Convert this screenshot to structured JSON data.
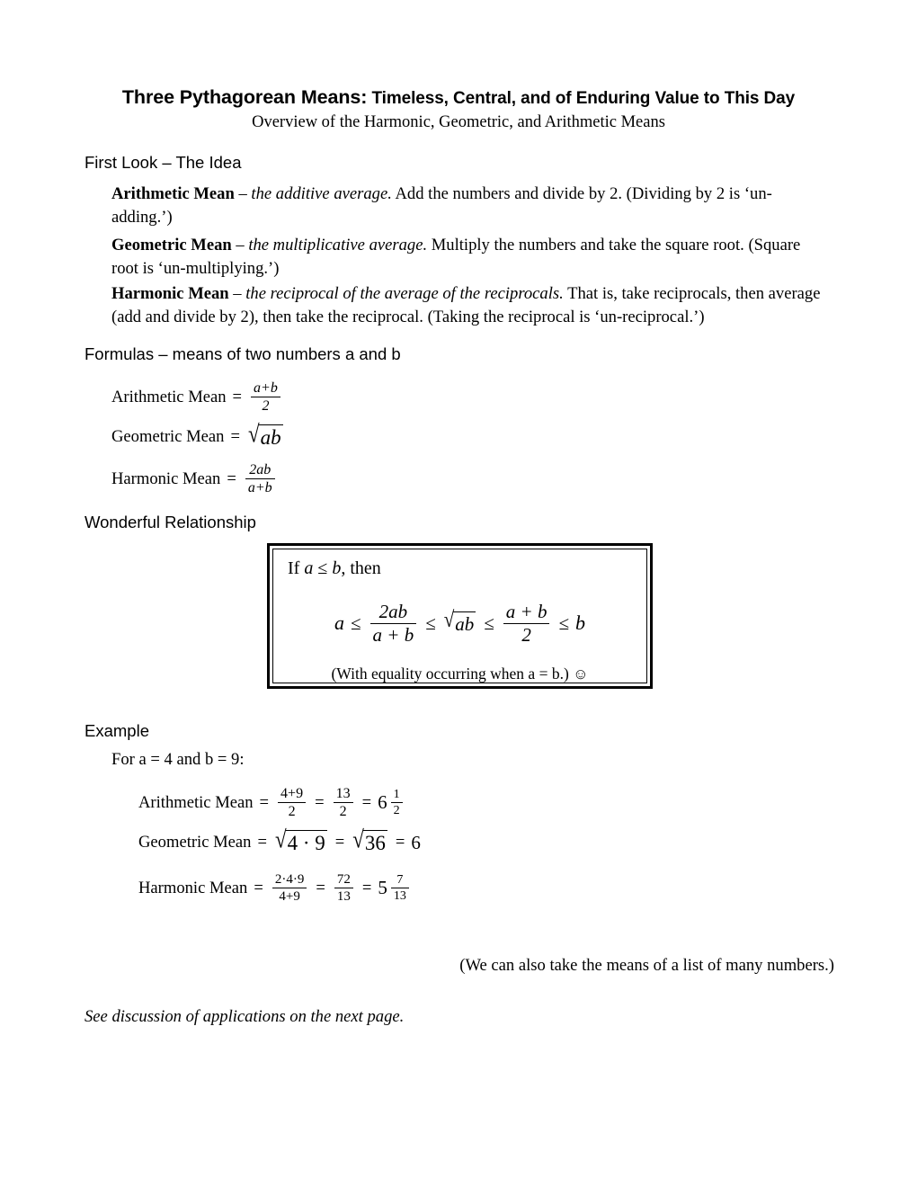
{
  "document": {
    "title_main": "Three Pythagorean Means:",
    "title_rest": " Timeless, Central, and of Enduring Value to This Day",
    "subtitle": "Overview of the Harmonic, Geometric, and Arithmetic Means"
  },
  "sections": {
    "first_look": {
      "heading": "First Look – The Idea",
      "items": [
        {
          "name": "Arithmetic Mean",
          "dash": " – ",
          "italic": "the additive average.",
          "rest": "  Add the numbers and divide by 2. (Dividing by 2 is ‘un-adding.’)"
        },
        {
          "name": "Geometric Mean",
          "dash": " – ",
          "italic": "the multiplicative average.",
          "rest": " Multiply the numbers and take the square root. (Square root is ‘un-multiplying.’)"
        },
        {
          "name": "Harmonic Mean",
          "dash": " – ",
          "italic": "the reciprocal of the average of the reciprocals.",
          "rest": "  That is, take reciprocals, then average (add and divide by 2), then take the reciprocal. (Taking the reciprocal is ‘un-reciprocal.’)"
        }
      ]
    },
    "formulas": {
      "heading": "Formulas – means of two numbers a and b",
      "arithmetic": {
        "label": "Arithmetic Mean",
        "equals": "=",
        "numerator": "a+b",
        "denominator": "2"
      },
      "geometric": {
        "label": "Geometric Mean",
        "equals": "=",
        "radical_sign": "√",
        "radicand": "ab"
      },
      "harmonic": {
        "label": "Harmonic Mean",
        "equals": "=",
        "numerator": "2ab",
        "denominator": "a+b"
      }
    },
    "relationship": {
      "heading": "Wonderful Relationship",
      "box": {
        "if_line": "If a ≤ b, then",
        "chain": {
          "a": "a",
          "le1": "≤",
          "harmonic_num": "2ab",
          "harmonic_den": "a + b",
          "le2": "≤",
          "radical_sign": "√",
          "radicand": "ab",
          "le3": "≤",
          "arith_num": "a + b",
          "arith_den": "2",
          "le4": "≤",
          "b": "b"
        },
        "note": "(With equality occurring when a = b.)",
        "smiley": "☺"
      }
    },
    "example": {
      "heading": "Example",
      "given": "For a = 4 and b = 9:",
      "arithmetic": {
        "label": "Arithmetic Mean",
        "equals": "=",
        "f1_num": "4+9",
        "f1_den": "2",
        "eq2": "=",
        "f2_num": "13",
        "f2_den": "2",
        "eq3": "=",
        "whole": "6",
        "f3_num": "1",
        "f3_den": "2"
      },
      "geometric": {
        "label": "Geometric Mean",
        "equals": "=",
        "radical_sign": "√",
        "radicand1": "4 · 9",
        "eq2": "=",
        "radicand2": "36",
        "eq3": "=",
        "result": "6"
      },
      "harmonic": {
        "label": "Harmonic Mean",
        "equals": "=",
        "f1_num": "2·4·9",
        "f1_den": "4+9",
        "eq2": "=",
        "f2_num": "72",
        "f2_den": "13",
        "eq3": "=",
        "whole": "5",
        "f3_num": "7",
        "f3_den": "13"
      }
    }
  },
  "notes": {
    "many_numbers": "(We can also take the means of a list of many numbers.)",
    "next_page": "See discussion of applications on the next page."
  }
}
